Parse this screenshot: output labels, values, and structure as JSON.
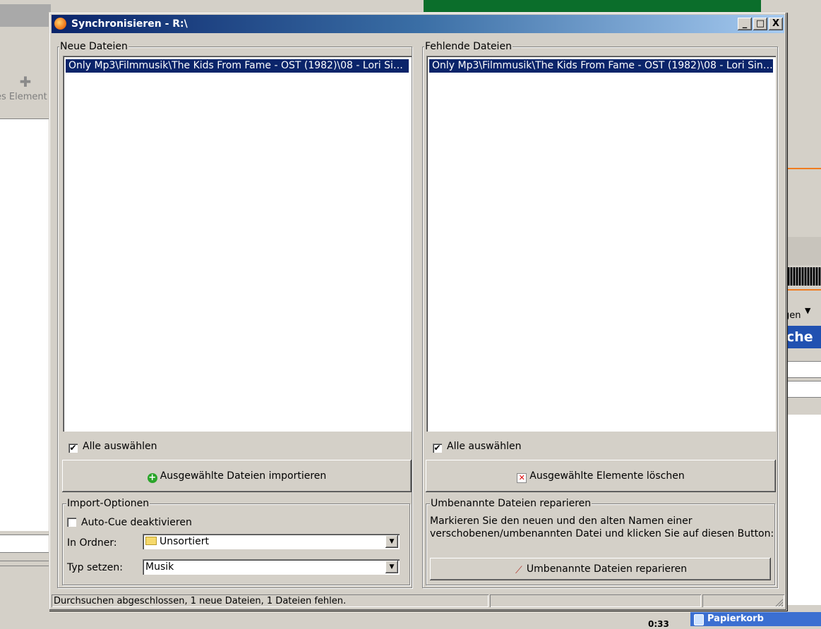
{
  "dialog": {
    "title": "Synchronisieren - R:\\",
    "buttons": {
      "minimize": "_",
      "maximize": "□",
      "close": "X"
    }
  },
  "new_files": {
    "group_label": "Neue Dateien",
    "items": [
      "Only Mp3\\Filmmusik\\The Kids From Fame - OST (1982)\\08 - Lori Sing..."
    ],
    "select_all_label": "Alle auswählen",
    "select_all_checked": true,
    "import_button_label": "Ausgewählte Dateien importieren",
    "import_button_icon": "green-plus-icon"
  },
  "missing_files": {
    "group_label": "Fehlende Dateien",
    "items": [
      "Only Mp3\\Filmmusik\\The Kids From Fame - OST (1982)\\08 - Lori Sing..."
    ],
    "select_all_label": "Alle auswählen",
    "select_all_checked": true,
    "delete_button_label": "Ausgewählte Elemente löschen",
    "delete_button_icon": "red-x-icon"
  },
  "import_options": {
    "group_label": "Import-Optionen",
    "auto_cue_label": "Auto-Cue deaktivieren",
    "auto_cue_checked": false,
    "folder_label": "In Ordner:",
    "folder_value": "Unsortiert",
    "type_label": "Typ setzen:",
    "type_value": "Musik"
  },
  "repair": {
    "group_label": "Umbenannte Dateien reparieren",
    "description_line1": "Markieren Sie den neuen und den alten Namen einer",
    "description_line2": "verschobenen/umbenannten Datei und klicken Sie auf diesen Button:",
    "button_label": "Umbenannte Dateien reparieren",
    "button_icon": "wrench-icon"
  },
  "status": {
    "text": "Durchsuchen abgeschlossen, 1 neue Dateien, 1 Dateien fehlen."
  },
  "background": {
    "left_button_label": "es Element",
    "right_dropdown_text": "gen",
    "right_blue_text": "che",
    "taskbar_clock": "0:33",
    "taskbar_item": "Papierkorb"
  }
}
